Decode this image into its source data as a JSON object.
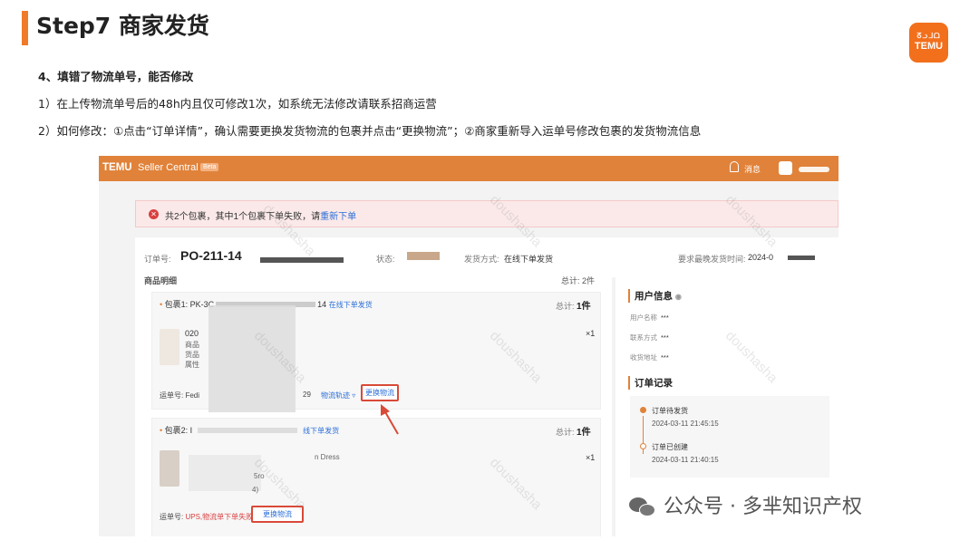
{
  "slide": {
    "title": "Step7 商家发货",
    "logo_glyphs": "ᘔᓗᒧᗝ",
    "logo_word": "TEMU",
    "lines": [
      "4、填错了物流单号，能否修改",
      "1）在上传物流单号后的48h内且仅可修改1次，如系统无法修改请联系招商运营",
      "2）如何修改：①点击“订单详情”，确认需要更换发货物流的包裹并点击“更换物流”；②商家重新导入运单号修改包裹的发货物流信息"
    ],
    "footer": "公众号 · 多芈知识产权"
  },
  "screenshot": {
    "brand": "TEMU",
    "seller_central": "Seller Central",
    "beta": "Beta",
    "message": "消息",
    "alert_text": "共2个包裹，其中1个包裹下单失败，请",
    "alert_link": "重新下单",
    "order_no_label": "订单号:",
    "order_no": "PO-211-14",
    "status_label": "状态:",
    "ship_method_label": "发货方式:",
    "ship_method": "在线下单发货",
    "deadline_label": "要求最晚发货时间:",
    "deadline": "2024-0",
    "watermark": "doushasha",
    "left_head": "商品明细",
    "left_head_total": "总计: 2件",
    "pkg1": {
      "label": "包裹1: PK-3C",
      "suffix": "14",
      "tag": "在线下单发货",
      "total_label": "总计:",
      "total": "1件",
      "qty": "×1",
      "code": "020",
      "line_a": "商品",
      "line_b": "货品",
      "line_c": "属性",
      "waybill_label": "运单号: Fedi",
      "waybill_tail": "29",
      "trace": "物流轨迹 ▿",
      "change": "更换物流"
    },
    "pkg2": {
      "label": "包裹2: I",
      "tag": "线下单发货",
      "total_label": "总计:",
      "total": "1件",
      "qty": "×1",
      "partial_a": "n Dress",
      "partial_b": "5ro",
      "partial_c": "4)",
      "waybill_label": "运单号:",
      "waybill_fail": "UPS,物流单下单失败",
      "change": "更换物流"
    },
    "user_info_title": "用户信息",
    "eye_icon": "◉",
    "user_rows": [
      {
        "label": "用户名称",
        "value": "***"
      },
      {
        "label": "联系方式",
        "value": "***"
      },
      {
        "label": "收货地址",
        "value": "***"
      }
    ],
    "records_title": "订单记录",
    "records": [
      {
        "title": "订单待发货",
        "time": "2024-03-11 21:45:15"
      },
      {
        "title": "订单已创建",
        "time": "2024-03-11 21:40:15"
      }
    ]
  }
}
